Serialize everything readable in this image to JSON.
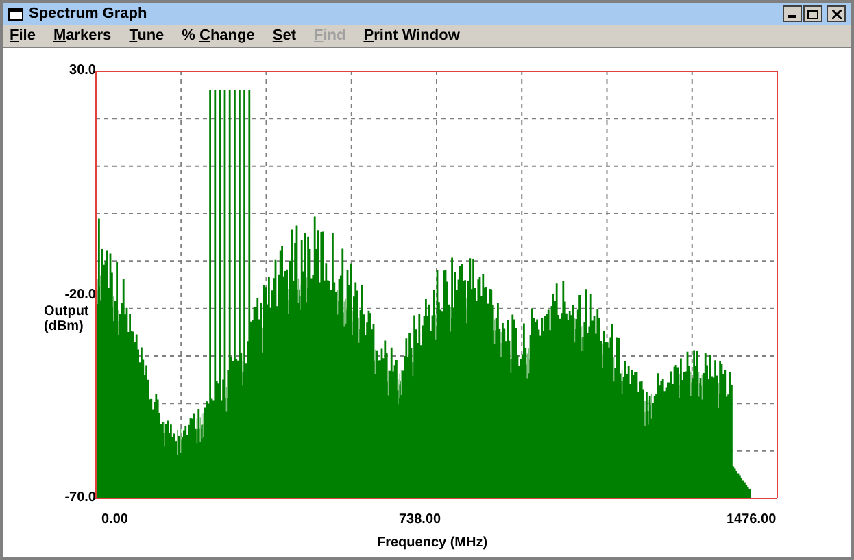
{
  "window": {
    "title": "Spectrum Graph"
  },
  "menu": [
    {
      "label": "File",
      "disabled": false
    },
    {
      "label": "Markers",
      "disabled": false
    },
    {
      "label": "Tune",
      "disabled": false
    },
    {
      "label": "% Change",
      "disabled": false
    },
    {
      "label": "Set",
      "disabled": false
    },
    {
      "label": "Find",
      "disabled": true
    },
    {
      "label": "Print Window",
      "disabled": false
    }
  ],
  "graph": {
    "y_ticks": [
      "30.0",
      "-20.0",
      "-70.0"
    ],
    "ylabel": [
      "Output",
      "(dBm)"
    ],
    "x_ticks": [
      "0.00",
      "738.00",
      "1476.00"
    ],
    "xlabel": "Frequency (MHz)"
  }
}
